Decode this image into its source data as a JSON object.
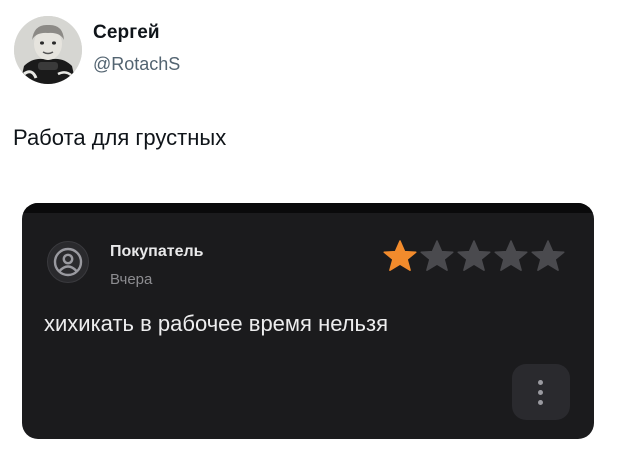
{
  "author": {
    "name": "Сергей",
    "handle": "@RotachS"
  },
  "tweet": {
    "text": "Работа для грустных"
  },
  "review": {
    "reviewer_name": "Покупатель",
    "date": "Вчера",
    "rating": 1,
    "max_rating": 5,
    "text": "хихикать в рабочее время нельзя",
    "star_active_color": "#f28b2c",
    "star_inactive_color": "#4a4a4e",
    "more_icon": "more-vertical-icon"
  }
}
